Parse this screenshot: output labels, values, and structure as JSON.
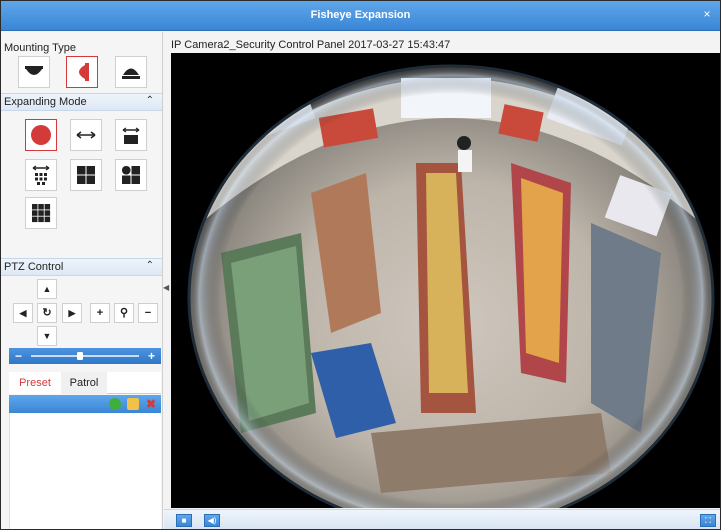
{
  "window": {
    "title": "Fisheye Expansion",
    "close_glyph": "×"
  },
  "mounting": {
    "label": "Mounting Type",
    "options": [
      {
        "icon": "ceiling-mount-icon",
        "selected": false
      },
      {
        "icon": "wall-mount-icon",
        "selected": true
      },
      {
        "icon": "desktop-mount-icon",
        "selected": false
      }
    ]
  },
  "expanding": {
    "label": "Expanding Mode",
    "chevron": "⌃",
    "options": [
      {
        "icon": "fisheye-icon",
        "selected": true
      },
      {
        "icon": "panorama-icon",
        "selected": false
      },
      {
        "icon": "panorama-ptz-icon",
        "selected": false
      },
      {
        "icon": "panorama-8ptz-icon",
        "selected": false
      },
      {
        "icon": "ptz-quad-icon",
        "selected": false
      },
      {
        "icon": "fisheye-3ptz-icon",
        "selected": false
      },
      {
        "icon": "fisheye-8ptz-icon",
        "selected": false
      }
    ]
  },
  "ptz": {
    "label": "PTZ Control",
    "chevron": "⌃",
    "up": "▲",
    "down": "▼",
    "left": "◀",
    "right": "▶",
    "auto": "↻",
    "zoom_in": "+",
    "zoom_out": "−",
    "zoom_icon": "⚲",
    "speed_minus": "−",
    "speed_plus": "+",
    "speed_level": 0.45
  },
  "tabs": {
    "preset": "Preset",
    "patrol": "Patrol"
  },
  "video": {
    "info": "IP Camera2_Security Control Panel  2017-03-27 15:43:47"
  },
  "bottom": {
    "stop": "■",
    "audio": "◀)"
  },
  "colors": {
    "accent": "#3a86d6",
    "selected": "#d43a3a",
    "call": "#3fae3a",
    "delete": "#d43a3a"
  }
}
